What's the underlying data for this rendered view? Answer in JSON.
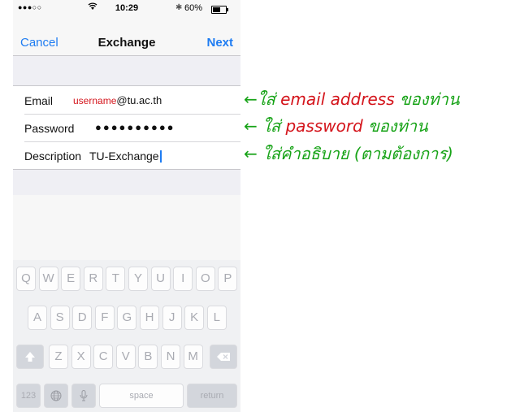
{
  "status_bar": {
    "signal": "●●●○○",
    "wifi_icon": "wifi-icon",
    "time": "10:29",
    "bluetooth": "✱",
    "battery_percent": "60%",
    "battery_level": 0.6
  },
  "nav": {
    "cancel": "Cancel",
    "title": "Exchange",
    "next": "Next"
  },
  "form": {
    "email_label": "Email",
    "email_user": "username",
    "email_domain": "@tu.ac.th",
    "password_label": "Password",
    "password_value": "●●●●●●●●●●",
    "description_label": "Description",
    "description_value": "TU-Exchange"
  },
  "keyboard": {
    "row1": [
      "Q",
      "W",
      "E",
      "R",
      "T",
      "Y",
      "U",
      "I",
      "O",
      "P"
    ],
    "row2": [
      "A",
      "S",
      "D",
      "F",
      "G",
      "H",
      "J",
      "K",
      "L"
    ],
    "row3": [
      "Z",
      "X",
      "C",
      "V",
      "B",
      "N",
      "M"
    ],
    "shift": "⇧",
    "delete": "⌫",
    "numbers": "123",
    "globe": "🌐",
    "mic": "🎙",
    "space": "space",
    "return": "return"
  },
  "annotations": {
    "email": {
      "prefix": "←ใส่ ",
      "highlight": "email address",
      "suffix": " ของท่าน"
    },
    "password": {
      "prefix": "← ใส่ ",
      "highlight": "password",
      "suffix": " ของท่าน"
    },
    "description": {
      "text": "← ใส่คำอธิบาย (ตามต้องการ)"
    }
  },
  "colors": {
    "accent": "#1e7cf2",
    "annotation_green": "#17a317",
    "annotation_red": "#d4141b"
  }
}
